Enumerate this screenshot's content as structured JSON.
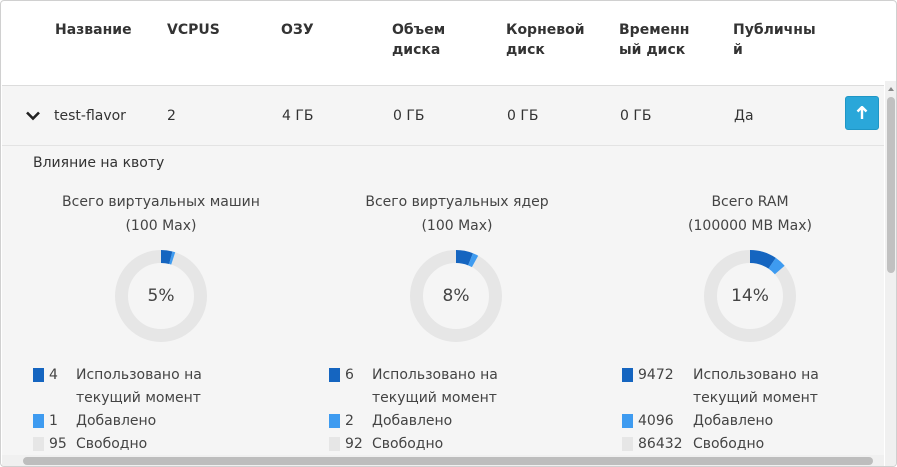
{
  "table": {
    "headers": [
      "Название",
      "VCPUS",
      "ОЗУ",
      "Объем диска",
      "Корневой диск",
      "Временный диск",
      "Публичный"
    ],
    "row": {
      "name": "test-flavor",
      "vcpus": "2",
      "ram": "4 ГБ",
      "disk": "0 ГБ",
      "root_disk": "0 ГБ",
      "ephemeral_disk": "0 ГБ",
      "public": "Да"
    }
  },
  "quota": {
    "title": "Влияние на квоту",
    "charts": [
      {
        "title": "Всего виртуальных машин",
        "max": "(100 Max)",
        "percent_label": "5%",
        "used_fraction": 0.04,
        "added_fraction": 0.01,
        "legend": {
          "used_value": "4",
          "used_label": "Использовано на",
          "used_label2": "текущий момент",
          "added_value": "1",
          "added_label": "Добавлено",
          "free_value": "95",
          "free_label": "Свободно"
        }
      },
      {
        "title": "Всего виртуальных ядер",
        "max": "(100 Max)",
        "percent_label": "8%",
        "used_fraction": 0.06,
        "added_fraction": 0.02,
        "legend": {
          "used_value": "6",
          "used_label": "Использовано на",
          "used_label2": "текущий момент",
          "added_value": "2",
          "added_label": "Добавлено",
          "free_value": "92",
          "free_label": "Свободно"
        }
      },
      {
        "title": "Всего RAM",
        "max": "(100000 MB Max)",
        "percent_label": "14%",
        "used_fraction": 0.09472,
        "added_fraction": 0.04096,
        "legend": {
          "used_value": "9472",
          "used_label": "Использовано на",
          "used_label2": "текущий момент",
          "added_value": "4096",
          "added_label": "Добавлено",
          "free_value": "86432",
          "free_label": "Свободно"
        }
      }
    ]
  },
  "colors": {
    "used": "#1565c0",
    "added": "#3e9bf0",
    "free": "#e6e6e6",
    "accent_button": "#2aa7d9"
  },
  "icons": {
    "expand": "chevron-down-icon",
    "action": "arrow-up-icon"
  }
}
